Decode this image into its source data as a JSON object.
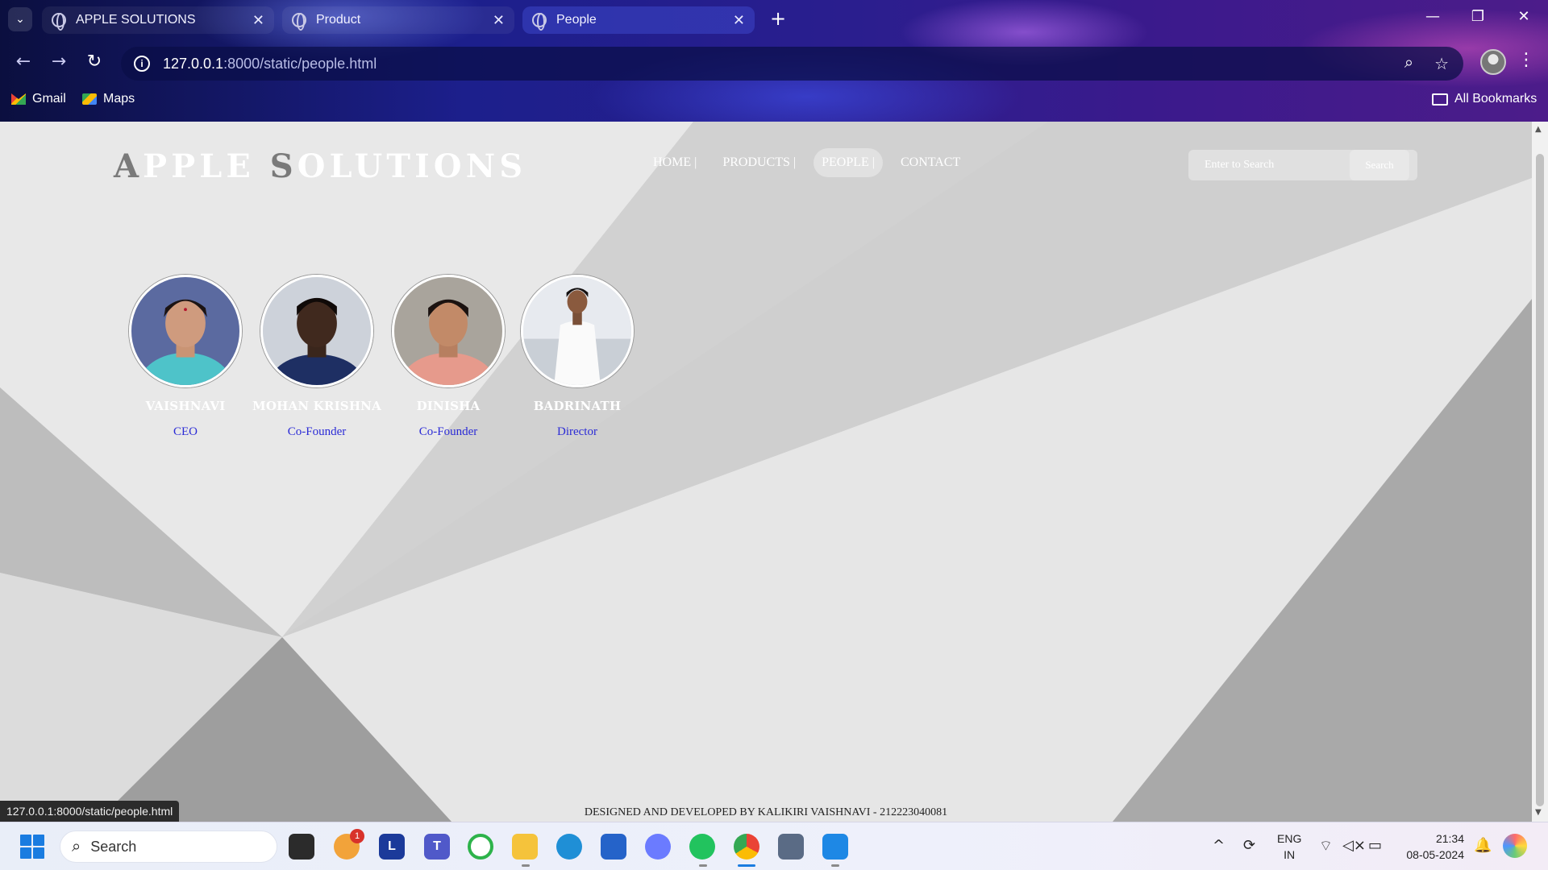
{
  "browser": {
    "tabs": [
      {
        "label": "APPLE SOLUTIONS",
        "active": false
      },
      {
        "label": "Product",
        "active": false
      },
      {
        "label": "People",
        "active": true
      }
    ],
    "url_host": "127.0.0.1",
    "url_path": ":8000/static/people.html",
    "bookmarks": [
      {
        "label": "Gmail",
        "icon": "gmail-icon"
      },
      {
        "label": "Maps",
        "icon": "maps-icon"
      }
    ],
    "all_bookmarks_label": "All Bookmarks",
    "status_url": "127.0.0.1:8000/static/people.html"
  },
  "site": {
    "logo_lead_1": "A",
    "logo_rest_1": "PPLE ",
    "logo_lead_2": "S",
    "logo_rest_2": "OLUTIONS",
    "nav": [
      {
        "label": "HOME |",
        "active": false
      },
      {
        "label": "PRODUCTS |",
        "active": false
      },
      {
        "label": "PEOPLE |",
        "active": true
      },
      {
        "label": "CONTACT",
        "active": false
      }
    ],
    "search_placeholder": "Enter to Search",
    "search_button": "Search",
    "people": [
      {
        "name": "VAISHNAVI",
        "role": "CEO"
      },
      {
        "name": "MOHAN KRISHNA",
        "role": "Co-Founder"
      },
      {
        "name": "DINISHA",
        "role": "Co-Founder"
      },
      {
        "name": "BADRINATH",
        "role": "Director"
      }
    ],
    "footer": "DESIGNED AND DEVELOPED BY KALIKIRI VAISHNAVI - 212223040081"
  },
  "taskbar": {
    "search_label": "Search",
    "notification_count": "1",
    "lang_line1": "ENG",
    "lang_line2": "IN",
    "time": "21:34",
    "date": "08-05-2024"
  },
  "colors": {
    "role_text": "#2b2bd6",
    "accent_windows": "#1a7ce0"
  }
}
